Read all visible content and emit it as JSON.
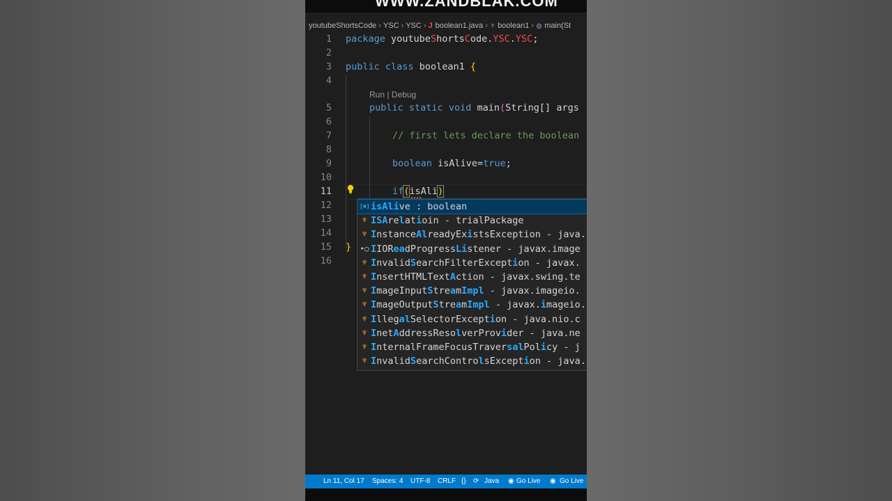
{
  "watermark": "WWW.ZANDBLAK.COM",
  "breadcrumb": [
    "youtubeShortsCode",
    "YSC",
    "YSC",
    "boolean1.java",
    "boolean1",
    "main(St"
  ],
  "codelens": "Run | Debug",
  "line_numbers": [
    "1",
    "2",
    "3",
    "4",
    "5",
    "6",
    "7",
    "8",
    "9",
    "10",
    "11",
    "12",
    "13",
    "14",
    "15",
    "16"
  ],
  "code": {
    "l1_kw": "package",
    "l1_a": "youtube",
    "l1_b": "S",
    "l1_c": "horts",
    "l1_d": "C",
    "l1_e": "ode.",
    "l1_f": "YSC",
    "l1_g": ".",
    "l1_h": "YSC",
    "l1_i": ";",
    "l3_kw1": "public",
    "l3_kw2": "class",
    "l3_name": "boolean1",
    "l3_br": "{",
    "l5_kw1": "public",
    "l5_kw2": "static",
    "l5_kw3": "void",
    "l5_fn": "main",
    "l5_p1": "(",
    "l5_type": "String[]",
    "l5_arg": "args",
    "l7_comment": "// first lets declare the boolean",
    "l9_kw": "boolean",
    "l9_var": "isAlive",
    "l9_eq": "=",
    "l9_val": "true",
    "l9_semi": ";",
    "l11_kw": "if",
    "l11_open": "(",
    "l11_var": "isAli",
    "l11_close": ")",
    "l15_br": "}"
  },
  "suggestions": [
    {
      "icon": "variable-icon",
      "glyph": "[⊛]",
      "parts": [
        [
          "isAli",
          true
        ],
        [
          "ve : boolean",
          false
        ]
      ]
    },
    {
      "icon": "class-icon",
      "glyph": "♆",
      "parts": [
        [
          "ISA",
          true
        ],
        [
          "re",
          false
        ],
        [
          "l",
          true
        ],
        [
          "at",
          false
        ],
        [
          "i",
          true
        ],
        [
          "oin - trialPackage",
          false
        ]
      ]
    },
    {
      "icon": "class-icon",
      "glyph": "♆",
      "parts": [
        [
          "I",
          true
        ],
        [
          "nstance",
          false
        ],
        [
          "Al",
          true
        ],
        [
          "readyEx",
          false
        ],
        [
          "i",
          true
        ],
        [
          "stsException - java.",
          false
        ]
      ]
    },
    {
      "icon": "interface-icon",
      "glyph": "•○",
      "parts": [
        [
          "I",
          true
        ],
        [
          "IOR",
          false
        ],
        [
          "ea",
          true
        ],
        [
          "dProgress",
          false
        ],
        [
          "Li",
          true
        ],
        [
          "stener - javax.image",
          false
        ]
      ]
    },
    {
      "icon": "class-icon",
      "glyph": "♆",
      "parts": [
        [
          "I",
          true
        ],
        [
          "nvalid",
          false
        ],
        [
          "S",
          true
        ],
        [
          "earchFilterExcept",
          false
        ],
        [
          "i",
          true
        ],
        [
          "on - javax.",
          false
        ]
      ]
    },
    {
      "icon": "class-icon",
      "glyph": "♆",
      "parts": [
        [
          "I",
          true
        ],
        [
          "nsertHTMLText",
          false
        ],
        [
          "A",
          true
        ],
        [
          "ction - javax.swing.te",
          false
        ]
      ]
    },
    {
      "icon": "class-icon",
      "glyph": "♆",
      "parts": [
        [
          "I",
          true
        ],
        [
          "mageInput",
          false
        ],
        [
          "S",
          true
        ],
        [
          "tre",
          false
        ],
        [
          "a",
          true
        ],
        [
          "m",
          false
        ],
        [
          "Impl",
          true
        ],
        [
          " - javax.imageio.",
          false
        ]
      ]
    },
    {
      "icon": "class-icon",
      "glyph": "♆",
      "parts": [
        [
          "I",
          true
        ],
        [
          "mageOutput",
          false
        ],
        [
          "S",
          true
        ],
        [
          "tre",
          false
        ],
        [
          "a",
          true
        ],
        [
          "m",
          false
        ],
        [
          "Impl",
          true
        ],
        [
          " - javax.",
          false
        ],
        [
          "i",
          true
        ],
        [
          "mageio.",
          false
        ]
      ]
    },
    {
      "icon": "class-icon",
      "glyph": "♆",
      "parts": [
        [
          "I",
          true
        ],
        [
          "lleg",
          false
        ],
        [
          "al",
          true
        ],
        [
          "SelectorExcept",
          false
        ],
        [
          "i",
          true
        ],
        [
          "on - java.nio.c",
          false
        ]
      ]
    },
    {
      "icon": "class-icon",
      "glyph": "♆",
      "parts": [
        [
          "I",
          true
        ],
        [
          "net",
          false
        ],
        [
          "A",
          true
        ],
        [
          "ddressReso",
          false
        ],
        [
          "l",
          true
        ],
        [
          "verProv",
          false
        ],
        [
          "i",
          true
        ],
        [
          "der - java.ne",
          false
        ]
      ]
    },
    {
      "icon": "class-icon",
      "glyph": "♆",
      "parts": [
        [
          "I",
          true
        ],
        [
          "nternalFrameFocusTraver",
          false
        ],
        [
          "sal",
          true
        ],
        [
          "Pol",
          false
        ],
        [
          "i",
          true
        ],
        [
          "cy - j",
          false
        ]
      ]
    },
    {
      "icon": "class-icon",
      "glyph": "♆",
      "parts": [
        [
          "I",
          true
        ],
        [
          "nvalid",
          false
        ],
        [
          "S",
          true
        ],
        [
          "earchContro",
          false
        ],
        [
          "l",
          true
        ],
        [
          "sExcept",
          false
        ],
        [
          "i",
          true
        ],
        [
          "on - java.",
          false
        ]
      ]
    }
  ],
  "statusbar": {
    "position": "Ln 11, Col 17",
    "spaces": "Spaces: 4",
    "encoding": "UTF-8",
    "eol": "CRLF",
    "language_glyph": "{}",
    "language": "Java",
    "golive1": "Go Live",
    "golive2": "Go Live"
  },
  "colors": {
    "accent": "#007acc",
    "editor_bg": "#1e1e1e",
    "keyword": "#569cd6",
    "match_highlight": "#2aaaff",
    "class_icon": "#ee9d28"
  }
}
